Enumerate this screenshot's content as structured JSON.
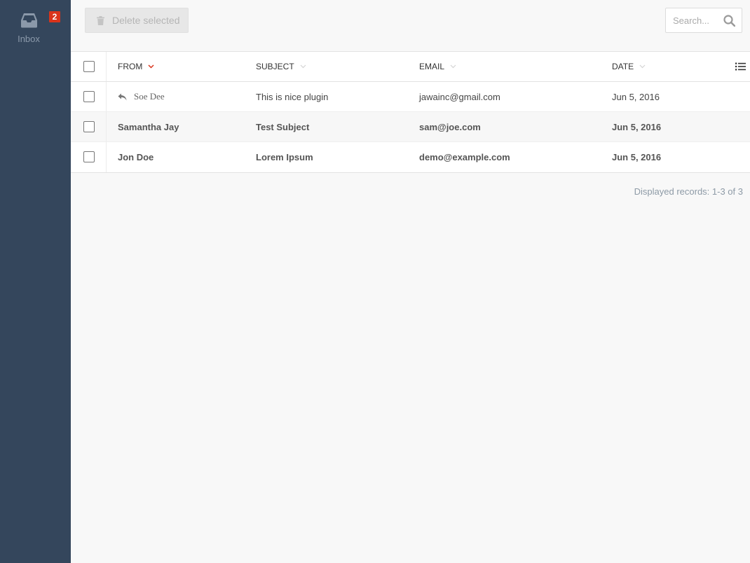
{
  "sidebar": {
    "inbox": {
      "label": "Inbox",
      "badge": "2",
      "icon": "inbox-icon"
    }
  },
  "toolbar": {
    "delete_label": "Delete selected",
    "search_placeholder": "Search...",
    "search_value": ""
  },
  "table": {
    "columns": {
      "from": "FROM",
      "subject": "SUBJECT",
      "email": "EMAIL",
      "date": "DATE"
    },
    "active_sort_color": "#d9341b",
    "rows": [
      {
        "from": "Soe Dee",
        "subject": "This is nice plugin",
        "email": "jawainc@gmail.com",
        "date": "Jun 5, 2016",
        "replied": true,
        "unread": false
      },
      {
        "from": "Samantha Jay",
        "subject": "Test Subject",
        "email": "sam@joe.com",
        "date": "Jun 5, 2016",
        "replied": false,
        "unread": true
      },
      {
        "from": "Jon Doe",
        "subject": "Lorem Ipsum",
        "email": "demo@example.com",
        "date": "Jun 5, 2016",
        "replied": false,
        "unread": true
      }
    ]
  },
  "footer": {
    "records_text": "Displayed records: 1-3 of 3"
  },
  "colors": {
    "sidebar_bg": "#34465c",
    "badge": "#d9341b"
  }
}
